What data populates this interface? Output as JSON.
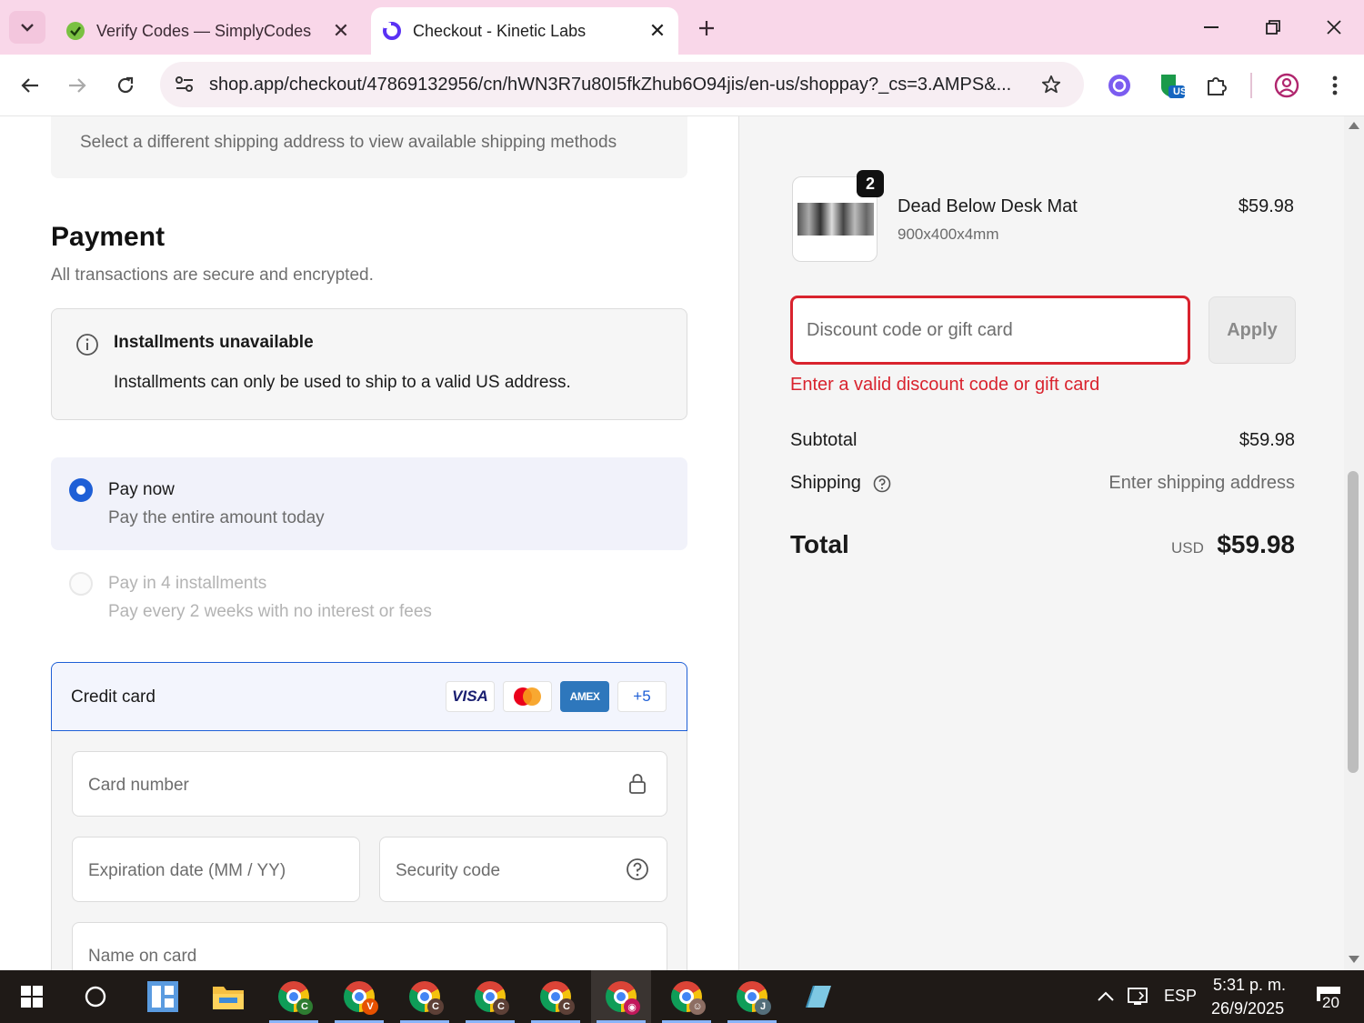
{
  "browser": {
    "tabs": [
      {
        "title": "Verify Codes — SimplyCodes",
        "active": false
      },
      {
        "title": "Checkout - Kinetic Labs",
        "active": true
      }
    ],
    "url": "shop.app/checkout/47869132956/cn/hWN3R7u80I5fkZhub6O94jis/en-us/shoppay?_cs=3.AMPS&...",
    "extension_badge": "US"
  },
  "checkout": {
    "shipping_note": "Select a different shipping address to view available shipping methods",
    "payment": {
      "title": "Payment",
      "subtitle": "All transactions are secure and encrypted.",
      "installments_notice": {
        "title": "Installments unavailable",
        "text": "Installments can only be used to ship to a valid US address."
      },
      "options": [
        {
          "title": "Pay now",
          "subtitle": "Pay the entire amount today",
          "selected": true
        },
        {
          "title": "Pay in 4 installments",
          "subtitle": "Pay every 2 weeks with no interest or fees",
          "selected": false
        }
      ],
      "credit_card": {
        "label": "Credit card",
        "logos": [
          "VISA",
          "AMEX",
          "+5"
        ],
        "fields": {
          "card_number": "Card number",
          "expiration": "Expiration date (MM / YY)",
          "security_code": "Security code",
          "name_on_card": "Name on card"
        }
      }
    }
  },
  "summary": {
    "product": {
      "quantity": "2",
      "name": "Dead Below Desk Mat",
      "variant": "900x400x4mm",
      "price": "$59.98"
    },
    "discount": {
      "placeholder": "Discount code or gift card",
      "apply_label": "Apply",
      "error": "Enter a valid discount code or gift card"
    },
    "subtotal_label": "Subtotal",
    "subtotal_value": "$59.98",
    "shipping_label": "Shipping",
    "shipping_value": "Enter shipping address",
    "total_label": "Total",
    "total_currency": "USD",
    "total_value": "$59.98"
  },
  "taskbar": {
    "apps": [
      {
        "name": "start",
        "badge": ""
      },
      {
        "name": "search",
        "badge": ""
      },
      {
        "name": "app-grid",
        "badge": ""
      },
      {
        "name": "file-explorer",
        "badge": ""
      },
      {
        "name": "chrome",
        "badge": "C"
      },
      {
        "name": "chrome",
        "badge": "V"
      },
      {
        "name": "chrome",
        "badge": "C"
      },
      {
        "name": "chrome",
        "badge": "C"
      },
      {
        "name": "chrome",
        "badge": "C"
      },
      {
        "name": "chrome",
        "badge": ""
      },
      {
        "name": "chrome",
        "badge": ""
      },
      {
        "name": "chrome",
        "badge": "J"
      }
    ],
    "language": "ESP",
    "time": "5:31 p. m.",
    "date": "26/9/2025",
    "notifications": "20"
  },
  "colors": {
    "accent": "#1e5fd6",
    "error": "#d9232e",
    "tabbar": "#f9d7e9",
    "amex": "#2e77bc"
  }
}
